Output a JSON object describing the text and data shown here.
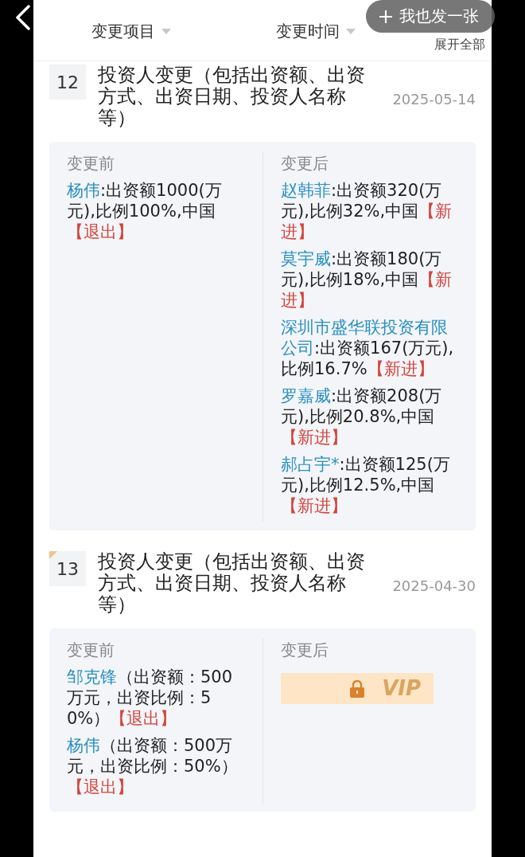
{
  "share_button": {
    "label": "我也发一张"
  },
  "filters": [
    {
      "label": "变更项目"
    },
    {
      "label": "变更时间"
    }
  ],
  "expand_all": "展开全部",
  "records": [
    {
      "index": "12",
      "flagged": false,
      "title": "投资人变更（包括出资额、出资方式、出资日期、投资人名称等）",
      "date": "2025-05-14",
      "before": {
        "heading": "变更前",
        "kind": "entries",
        "entries": [
          {
            "name": "杨伟",
            "detail": ":出资额1000(万元),比例100%,中国",
            "tag": "【退出】"
          }
        ]
      },
      "after": {
        "heading": "变更后",
        "kind": "entries",
        "entries": [
          {
            "name": "赵韩菲",
            "detail": ":出资额320(万元),比例32%,中国",
            "tag": "【新进】"
          },
          {
            "name": "莫宇威",
            "detail": ":出资额180(万元),比例18%,中国",
            "tag": "【新进】"
          },
          {
            "name": "深圳市盛华联投资有限公司",
            "detail": ":出资额167(万元),比例16.7%",
            "tag": "【新进】"
          },
          {
            "name": "罗嘉威",
            "detail": ":出资额208(万元),比例20.8%,中国",
            "tag": "【新进】"
          },
          {
            "name": "郝占宇*",
            "detail": ":出资额125(万元),比例12.5%,中国",
            "tag": "【新进】"
          }
        ]
      }
    },
    {
      "index": "13",
      "flagged": true,
      "title": "投资人变更（包括出资额、出资方式、出资日期、投资人名称等）",
      "date": "2025-04-30",
      "before": {
        "heading": "变更前",
        "kind": "entries",
        "entries": [
          {
            "name": "邹克锋",
            "detail": "（出资额：500万元，出资比例：50%）",
            "tag": "【退出】"
          },
          {
            "name": "杨伟",
            "detail": "（出资额：500万元，出资比例：50%）",
            "tag": "【退出】"
          }
        ]
      },
      "after": {
        "heading": "变更后",
        "kind": "locked",
        "badge": "VIP"
      }
    }
  ]
}
